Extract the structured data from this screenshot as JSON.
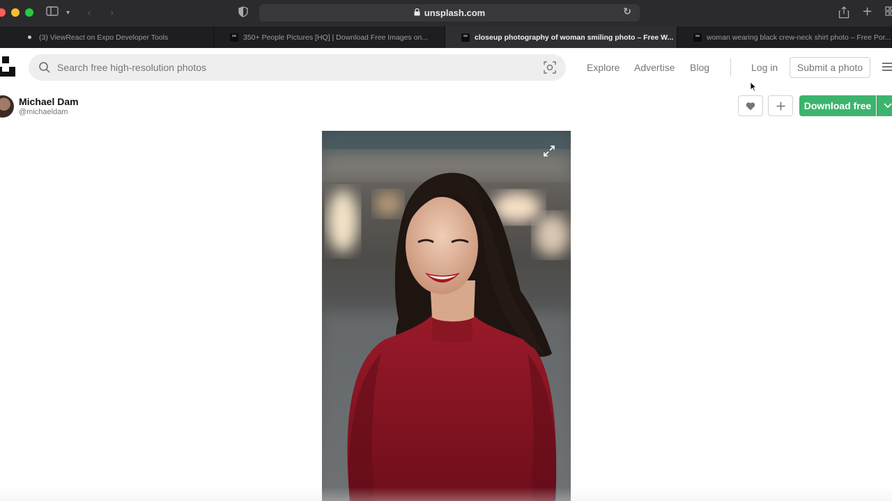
{
  "browser": {
    "url": "unsplash.com",
    "tabs": [
      {
        "label": "(3) ViewReact on Expo Developer Tools",
        "active": false,
        "icon": "dot-icon"
      },
      {
        "label": "350+ People Pictures [HQ] | Download Free Images on...",
        "active": false,
        "icon": "unsplash-icon"
      },
      {
        "label": "closeup photography of woman smiling photo – Free W...",
        "active": true,
        "icon": "unsplash-icon"
      },
      {
        "label": "woman wearing black crew-neck shirt photo – Free Por...",
        "active": false,
        "icon": "unsplash-icon"
      }
    ]
  },
  "header": {
    "search_placeholder": "Search free high-resolution photos",
    "nav": {
      "explore": "Explore",
      "advertise": "Advertise",
      "blog": "Blog",
      "login": "Log in",
      "submit": "Submit a photo"
    }
  },
  "photo": {
    "author_name": "Michael Dam",
    "author_handle": "@michaeldam",
    "download_label": "Download free"
  },
  "colors": {
    "brand_green": "#3cb46e",
    "shirt_red": "#8e1422",
    "chrome_dark": "#2b2b2d"
  }
}
